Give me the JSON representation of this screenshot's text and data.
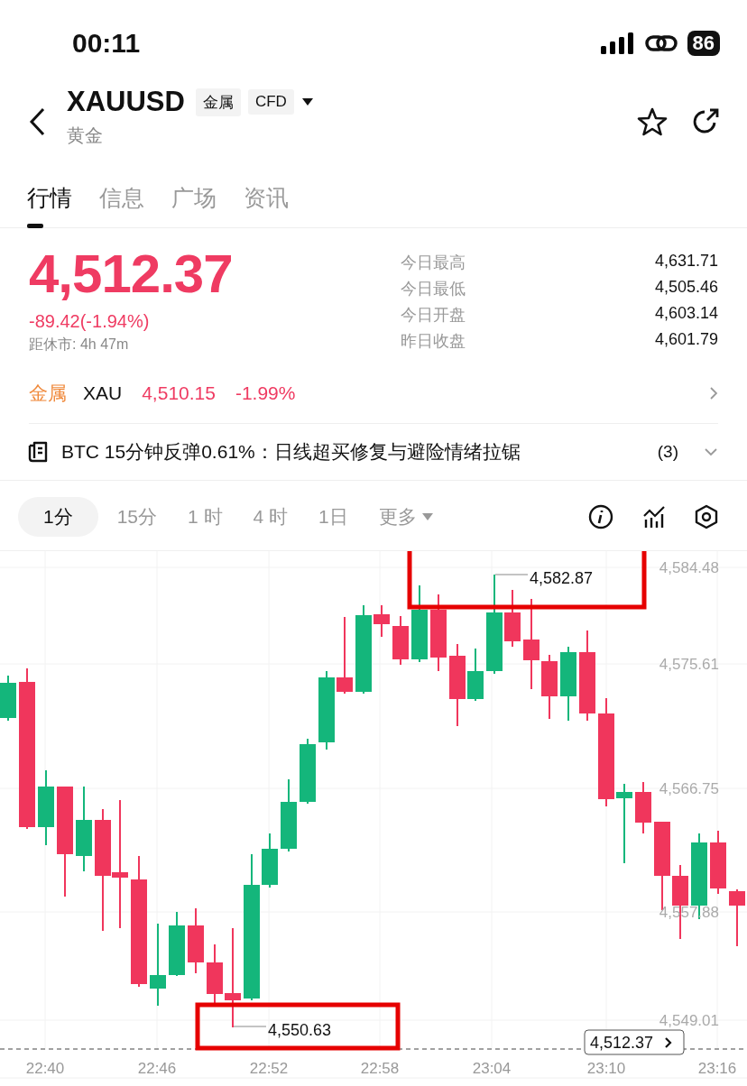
{
  "status_bar": {
    "time": "00:11",
    "battery": "86"
  },
  "header": {
    "symbol": "XAUUSD",
    "tags": [
      "金属",
      "CFD"
    ],
    "subtitle": "黄金",
    "favorite": false
  },
  "tabs": [
    {
      "label": "行情",
      "selected": true
    },
    {
      "label": "信息",
      "selected": false
    },
    {
      "label": "广场",
      "selected": false
    },
    {
      "label": "资讯",
      "selected": false
    }
  ],
  "quote": {
    "price": "4,512.37",
    "change": "-89.42(-1.94%)",
    "countdown": "距休市: 4h 47m",
    "stats": [
      {
        "label": "今日最高",
        "value": "4,631.71"
      },
      {
        "label": "今日最低",
        "value": "4,505.46"
      },
      {
        "label": "今日开盘",
        "value": "4,603.14"
      },
      {
        "label": "昨日收盘",
        "value": "4,601.79"
      }
    ]
  },
  "sector": {
    "category": "金属",
    "symbol": "XAU",
    "price": "4,510.15",
    "change": "-1.99%"
  },
  "news": {
    "headline": "BTC 15分钟反弹0.61%：日线超买修复与避险情绪拉锯",
    "count": "(3)"
  },
  "intervals": [
    {
      "label": "1分",
      "selected": true,
      "kind": "plain"
    },
    {
      "label": "15分",
      "selected": false,
      "kind": "plain"
    },
    {
      "label": "1 时",
      "selected": false,
      "kind": "plain"
    },
    {
      "label": "4 时",
      "selected": false,
      "kind": "plain"
    },
    {
      "label": "1日",
      "selected": false,
      "kind": "plain"
    },
    {
      "label": "更多",
      "selected": false,
      "kind": "dropdown"
    }
  ],
  "chart": {
    "y_labels": [
      "4,584.48",
      "4,575.61",
      "4,566.75",
      "4,557.88",
      "4,549.01"
    ],
    "x_labels": [
      "22:40",
      "22:46",
      "22:52",
      "22:58",
      "23:04",
      "23:10",
      "23:16"
    ],
    "high_marker": "4,582.87",
    "low_marker": "4,550.63",
    "last_price": "4,512.37"
  }
}
